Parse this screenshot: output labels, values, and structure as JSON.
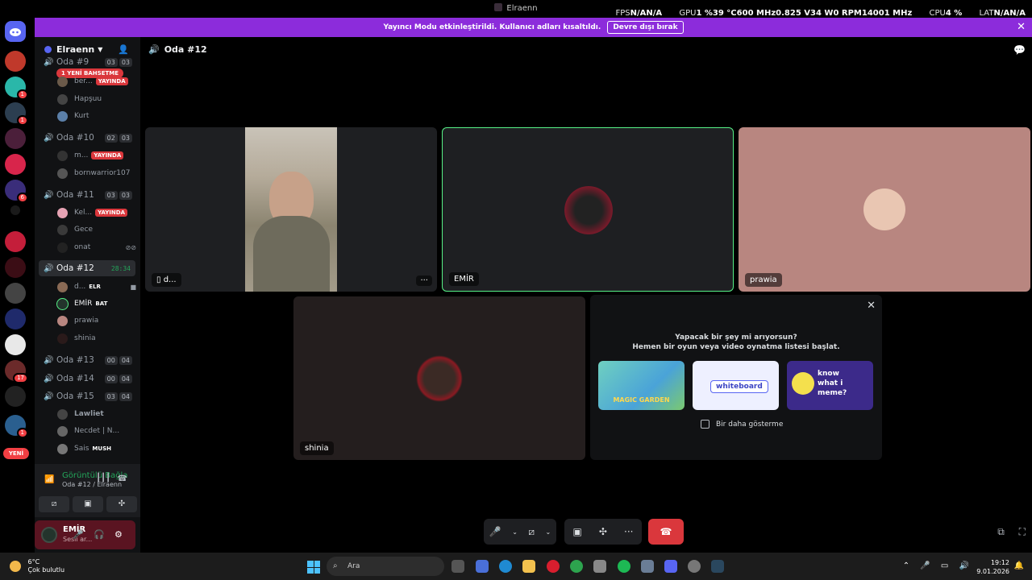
{
  "window": {
    "title": "Elraenn"
  },
  "overlay": {
    "fps_label": "FPS",
    "fps_value": "N/A",
    "fps_value2": "N/A",
    "gpu_label": "GPU",
    "gpu_load": "1 %",
    "gpu_temp": "39 °C",
    "gpu_clock": "600 MHz",
    "gpu_volt": "0.825 V",
    "gpu_power": "34 W",
    "gpu_fan": "0 RPM",
    "gpu_mem": "14001 MHz",
    "cpu_label": "CPU",
    "cpu_load": "4 %",
    "lat_label": "LAT",
    "lat_value": "N/A",
    "lat_value2": "N/A"
  },
  "streamer_bar": {
    "message": "Yayıncı Modu etkinleştirildi. Kullanıcı adları kısaltıldı.",
    "button": "Devre dışı bırak"
  },
  "guilds": {
    "new_label": "YENİ",
    "badges": [
      "1",
      "1",
      "6",
      "17",
      "1"
    ]
  },
  "server": {
    "name": "Elraenn"
  },
  "mention_pill": "1 YENİ BAHSETME",
  "channels": [
    {
      "name": "Oda #9",
      "c1": "03",
      "c2": "03"
    },
    {
      "name": "Oda #10",
      "c1": "02",
      "c2": "03"
    },
    {
      "name": "Oda #11",
      "c1": "03",
      "c2": "03"
    },
    {
      "name": "Oda #12",
      "time": "28:34"
    },
    {
      "name": "Oda #13",
      "c1": "00",
      "c2": "04"
    },
    {
      "name": "Oda #14",
      "c1": "00",
      "c2": "04"
    },
    {
      "name": "Oda #15",
      "c1": "03",
      "c2": "04"
    }
  ],
  "members": {
    "oda9": [
      {
        "name": "ber...",
        "live": "YAYINDA"
      },
      {
        "name": "Hapşuu"
      },
      {
        "name": "Kurt"
      }
    ],
    "oda10": [
      {
        "name": "m...",
        "live": "YAYINDA"
      },
      {
        "name": "bornwarrior107"
      }
    ],
    "oda11": [
      {
        "name": "Kel...",
        "live": "YAYINDA"
      },
      {
        "name": "Gece"
      },
      {
        "name": "onat"
      }
    ],
    "oda12": [
      {
        "name": "d...",
        "tag": "ELR"
      },
      {
        "name": "EMİR",
        "tag": "BAT"
      },
      {
        "name": "prawia"
      },
      {
        "name": "shinia"
      }
    ],
    "oda15": [
      {
        "name": "Lawliet"
      },
      {
        "name": "Necdet | N..."
      },
      {
        "name": "Sais",
        "tag": "MUSH"
      }
    ]
  },
  "voice_panel": {
    "title": "Görüntülü Bağla",
    "subtitle": "Oda #12 / Elraenn"
  },
  "user_panel": {
    "name": "EMİR",
    "status": "Sesli ar..."
  },
  "main": {
    "channel": "Oda #12"
  },
  "tiles": [
    {
      "label": "d..."
    },
    {
      "label": "EMİR"
    },
    {
      "label": "prawia"
    },
    {
      "label": "shinia"
    }
  ],
  "promo": {
    "line1": "Yapacak bir şey mi arıyorsun?",
    "line2": "Hemen bir oyun veya video oynatma listesi başlat.",
    "activities": [
      "MAGIC GARDEN",
      "whiteboard",
      "know what i meme?"
    ],
    "checkbox": "Bir daha gösterme"
  },
  "taskbar": {
    "temp": "6°C",
    "weather": "Çok bulutlu",
    "search": "Ara",
    "time": "19:12",
    "date": "9.01.2026"
  },
  "colors": {
    "accent": "#8c2cdb",
    "live": "#da373c",
    "voice": "#23a55a",
    "speaking": "#57f287"
  }
}
